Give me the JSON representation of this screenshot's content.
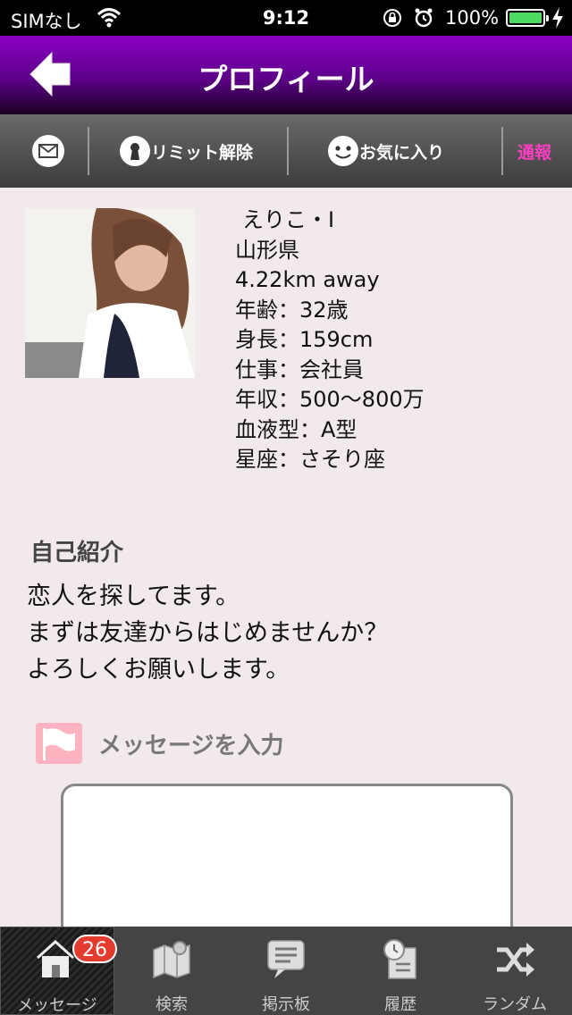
{
  "status_bar": {
    "carrier": "SIMなし",
    "time": "9:12",
    "battery_pct": "100%",
    "battery_level": 1.0
  },
  "nav": {
    "title": "プロフィール"
  },
  "actions": {
    "limit_label": "リミット解除",
    "favorite_label": "お気に入り",
    "report_label": "通報",
    "report_color": "#ff3fc0"
  },
  "profile": {
    "name": "えりこ・I",
    "prefecture": "山形県",
    "distance": "4.22km away",
    "age": "年齢：32歳",
    "height": "身長：159cm",
    "job": "仕事：会社員",
    "income": "年収：500〜800万",
    "blood": "血液型：A型",
    "zodiac": "星座：さそり座"
  },
  "intro": {
    "title": "自己紹介",
    "body": " 恋人を探してます。\nまずは友達からはじめませんか？\nよろしくお願いします。"
  },
  "message": {
    "label": "メッセージを入力",
    "value": ""
  },
  "tabs": [
    {
      "label": "メッセージ",
      "badge": "26",
      "icon": "house-icon"
    },
    {
      "label": "検索",
      "icon": "map-icon"
    },
    {
      "label": "掲示板",
      "icon": "board-icon"
    },
    {
      "label": "履歴",
      "icon": "history-icon"
    },
    {
      "label": "ランダム",
      "icon": "random-icon"
    }
  ]
}
